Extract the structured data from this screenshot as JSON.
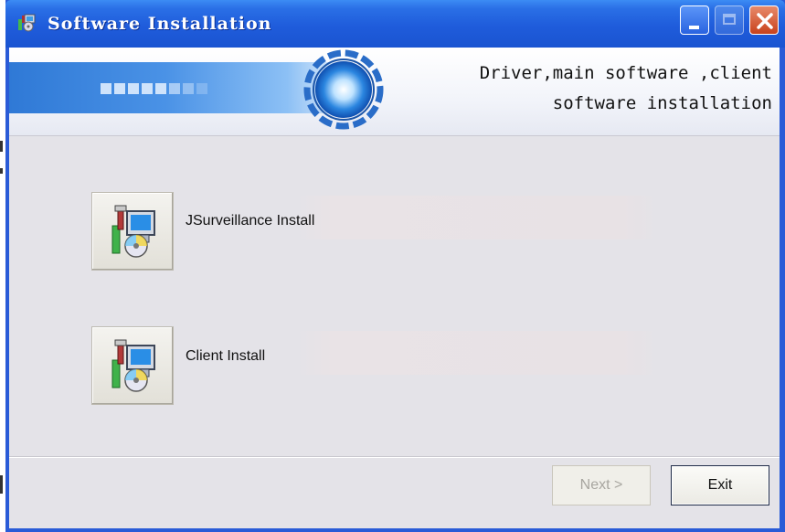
{
  "window": {
    "title": "Software Installation"
  },
  "banner": {
    "line1": "Driver,main software ,client",
    "line2": "software installation"
  },
  "main": {
    "options": [
      {
        "label": "JSurveillance Install"
      },
      {
        "label": "Client Install"
      }
    ]
  },
  "footer": {
    "next_label": "Next >",
    "next_enabled": false,
    "exit_label": "Exit"
  },
  "icons": {
    "title": "setup-icon",
    "install": "install-computer-cd-icon",
    "minimize": "minimize-icon",
    "maximize": "maximize-icon",
    "close": "close-icon"
  },
  "colors": {
    "titlebar": "#1f5cdb",
    "client_bg": "#e4e3e8",
    "banner_accent": "#2f79d6"
  }
}
